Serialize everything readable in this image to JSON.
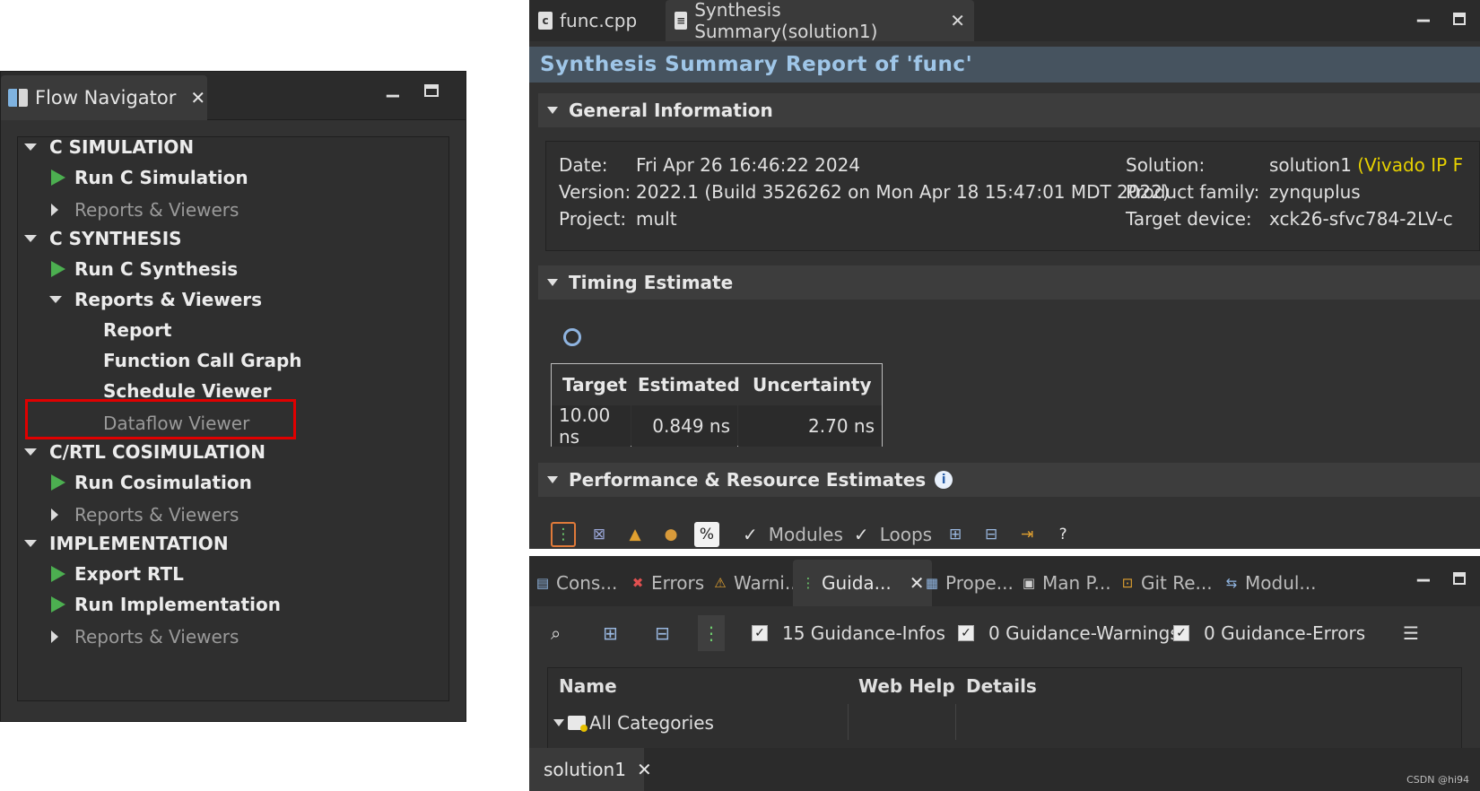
{
  "flow_navigator": {
    "title": "Flow Navigator",
    "minimize": "▬",
    "maximize": "▪",
    "items": [
      {
        "kind": "section",
        "label": "C SIMULATION"
      },
      {
        "kind": "run",
        "label": "Run C Simulation"
      },
      {
        "kind": "collapsed",
        "label": "Reports & Viewers"
      },
      {
        "kind": "section",
        "label": "C SYNTHESIS"
      },
      {
        "kind": "run",
        "label": "Run C Synthesis"
      },
      {
        "kind": "expanded",
        "label": "Reports & Viewers"
      },
      {
        "kind": "leaf",
        "label": "Report"
      },
      {
        "kind": "leaf",
        "label": "Function Call Graph"
      },
      {
        "kind": "leaf",
        "label": "Schedule Viewer"
      },
      {
        "kind": "leaf-dim",
        "label": "Dataflow Viewer"
      },
      {
        "kind": "section",
        "label": "C/RTL COSIMULATION"
      },
      {
        "kind": "run",
        "label": "Run Cosimulation"
      },
      {
        "kind": "collapsed",
        "label": "Reports & Viewers"
      },
      {
        "kind": "section",
        "label": "IMPLEMENTATION"
      },
      {
        "kind": "run",
        "label": "Export RTL"
      },
      {
        "kind": "run",
        "label": "Run Implementation"
      },
      {
        "kind": "collapsed",
        "label": "Reports & Viewers"
      }
    ]
  },
  "editor": {
    "tabs": [
      {
        "label": "func.cpp",
        "icon": "cpp-file-icon"
      },
      {
        "label": "Synthesis Summary(solution1)",
        "icon": "report-file-icon"
      }
    ],
    "report_title": "Synthesis Summary Report of 'func'",
    "general": {
      "heading": "General Information",
      "date_label": "Date:",
      "date": "Fri Apr 26 16:46:22 2024",
      "version_label": "Version:",
      "version": "2022.1 (Build 3526262 on Mon Apr 18 15:47:01 MDT 2022)",
      "project_label": "Project:",
      "project": "mult",
      "solution_label": "Solution:",
      "solution": "solution1",
      "solution_extra": "(Vivado IP F",
      "family_label": "Product family:",
      "family": "zynquplus",
      "device_label": "Target device:",
      "device": "xck26-sfvc784-2LV-c"
    },
    "timing": {
      "heading": "Timing Estimate",
      "headers": [
        "Target",
        "Estimated",
        "Uncertainty"
      ],
      "values": [
        "10.00 ns",
        "0.849 ns",
        "2.70 ns"
      ]
    },
    "perf": {
      "heading": "Performance & Resource Estimates",
      "modules_label": "Modules",
      "loops_label": "Loops"
    }
  },
  "bottom": {
    "tabs": [
      {
        "label": "Cons...",
        "icon": "console-icon"
      },
      {
        "label": "Errors",
        "icon": "error-icon"
      },
      {
        "label": "Warni...",
        "icon": "warning-icon"
      },
      {
        "label": "Guida...",
        "icon": "guidance-icon"
      },
      {
        "label": "Prope...",
        "icon": "properties-icon"
      },
      {
        "label": "Man P...",
        "icon": "man-pages-icon"
      },
      {
        "label": "Git Re...",
        "icon": "git-icon"
      },
      {
        "label": "Modul...",
        "icon": "module-icon"
      }
    ],
    "filters": {
      "infos": "15 Guidance-Infos",
      "warnings": "0 Guidance-Warnings",
      "errors": "0 Guidance-Errors"
    },
    "columns": [
      "Name",
      "Web Help",
      "Details"
    ],
    "row": "All Categories",
    "solution_tab": "solution1"
  },
  "watermark": "CSDN @hi94",
  "colors": {
    "accent_title": "#9fc6e8",
    "run_icon": "#4caf50",
    "highlight": "#e00000",
    "vivado_note": "#e6d000"
  }
}
